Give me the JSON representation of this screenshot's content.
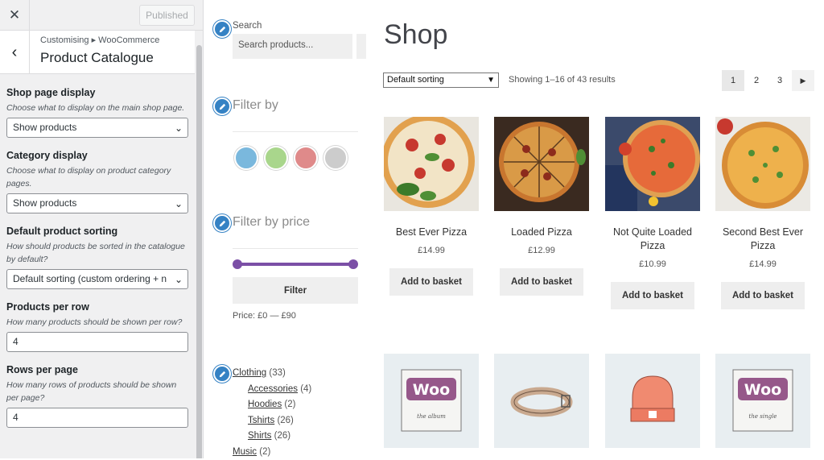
{
  "customizer": {
    "close_icon": "close-icon",
    "publish_label": "Published",
    "breadcrumb": "Customising ▸ WooCommerce",
    "title": "Product Catalogue",
    "fields": [
      {
        "label": "Shop page display",
        "desc": "Choose what to display on the main shop page.",
        "value": "Show products",
        "type": "select"
      },
      {
        "label": "Category display",
        "desc": "Choose what to display on product category pages.",
        "value": "Show products",
        "type": "select"
      },
      {
        "label": "Default product sorting",
        "desc": "How should products be sorted in the catalogue by default?",
        "value": "Default sorting (custom ordering + n",
        "type": "select"
      },
      {
        "label": "Products per row",
        "desc": "How many products should be shown per row?",
        "value": "4",
        "type": "input"
      },
      {
        "label": "Rows per page",
        "desc": "How many rows of products should be shown per page?",
        "value": "4",
        "type": "input"
      }
    ]
  },
  "widgets": {
    "search_label": "Search",
    "search_placeholder": "Search products...",
    "filter_by": "Filter by",
    "swatches": [
      "#7ab8dd",
      "#a9d68c",
      "#df8a8a",
      "#cccccc"
    ],
    "filter_by_price": "Filter by price",
    "filter_button": "Filter",
    "price_text": "Price: £0 — £90",
    "categories": [
      {
        "name": "Clothing",
        "count": "(33)",
        "sub": false
      },
      {
        "name": "Accessories",
        "count": "(4)",
        "sub": true
      },
      {
        "name": "Hoodies",
        "count": "(2)",
        "sub": true
      },
      {
        "name": "Tshirts",
        "count": "(26)",
        "sub": true
      },
      {
        "name": "Shirts",
        "count": "(26)",
        "sub": true
      },
      {
        "name": "Music",
        "count": "(2)",
        "sub": false
      }
    ]
  },
  "shop": {
    "title": "Shop",
    "sort_value": "Default sorting",
    "result_count": "Showing 1–16 of 43 results",
    "pages": [
      "1",
      "2",
      "3"
    ],
    "current_page": "1",
    "products": [
      {
        "name": "Best Ever Pizza",
        "price": "£14.99",
        "button": "Add to basket"
      },
      {
        "name": "Loaded Pizza",
        "price": "£12.99",
        "button": "Add to basket"
      },
      {
        "name": "Not Quite Loaded Pizza",
        "price": "£10.99",
        "button": "Add to basket"
      },
      {
        "name": "Second Best Ever Pizza",
        "price": "£14.99",
        "button": "Add to basket"
      }
    ],
    "row2_images": [
      "woo-album",
      "belt",
      "beanie",
      "woo-single"
    ],
    "woo_text": "Woo",
    "woo_album_sub": "the album",
    "woo_single_sub": "the single"
  }
}
